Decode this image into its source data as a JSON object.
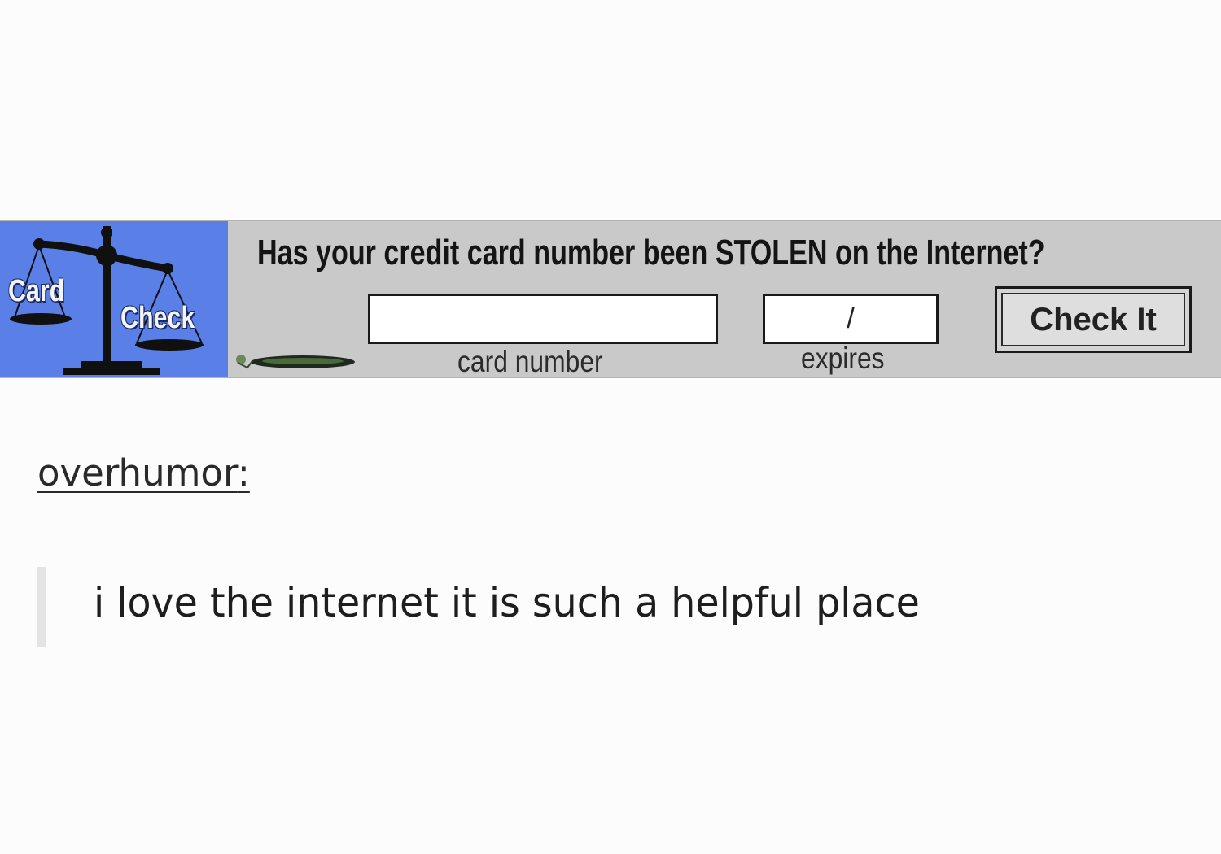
{
  "banner": {
    "logo_word_1": "Card",
    "logo_word_2": "Check",
    "logo_icon": "scales-of-justice-icon",
    "headline": "Has your credit card number been STOLEN on the Internet?",
    "card_number_value": "",
    "card_number_label": "card number",
    "expires_value": "/",
    "expires_label": "expires",
    "check_button_label": "Check It",
    "colors": {
      "logo_background": "#5a7fe6",
      "banner_background": "#c9c9c9"
    }
  },
  "post": {
    "username": "overhumor",
    "username_suffix": ":",
    "quote": "i love the internet it is such a helpful place"
  }
}
